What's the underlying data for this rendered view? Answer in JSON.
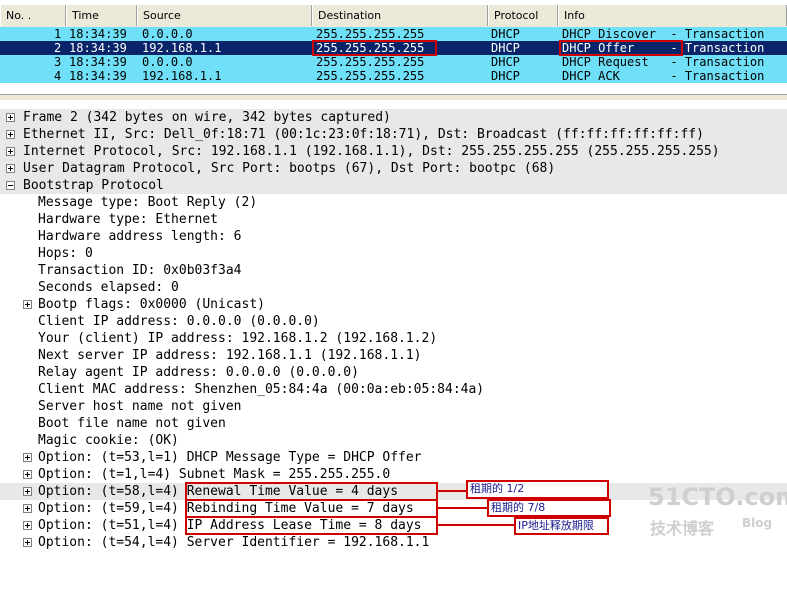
{
  "packet_list": {
    "columns": [
      "No. .",
      "Time",
      "Source",
      "Destination",
      "Protocol",
      "Info"
    ],
    "rows": [
      {
        "no": "1",
        "time": "18:34:39",
        "source": "0.0.0.0",
        "destination": "255.255.255.255",
        "protocol": "DHCP",
        "info": "DHCP Discover  - Transaction"
      },
      {
        "no": "2",
        "time": "18:34:39",
        "source": "192.168.1.1",
        "destination": "255.255.255.255",
        "protocol": "DHCP",
        "info": "DHCP Offer     - Transaction"
      },
      {
        "no": "3",
        "time": "18:34:39",
        "source": "0.0.0.0",
        "destination": "255.255.255.255",
        "protocol": "DHCP",
        "info": "DHCP Request   - Transaction"
      },
      {
        "no": "4",
        "time": "18:34:39",
        "source": "192.168.1.1",
        "destination": "255.255.255.255",
        "protocol": "DHCP",
        "info": "DHCP ACK       - Transaction"
      }
    ],
    "selected_row": 2
  },
  "detail_tree": [
    {
      "text": "Frame 2 (342 bytes on wire, 342 bytes captured)",
      "indent": 0,
      "expander": "plus"
    },
    {
      "text": "Ethernet II, Src: Dell_0f:18:71 (00:1c:23:0f:18:71), Dst: Broadcast (ff:ff:ff:ff:ff:ff)",
      "indent": 0,
      "expander": "plus"
    },
    {
      "text": "Internet Protocol, Src: 192.168.1.1 (192.168.1.1), Dst: 255.255.255.255 (255.255.255.255)",
      "indent": 0,
      "expander": "plus"
    },
    {
      "text": "User Datagram Protocol, Src Port: bootps (67), Dst Port: bootpc (68)",
      "indent": 0,
      "expander": "plus"
    },
    {
      "text": "Bootstrap Protocol",
      "indent": 0,
      "expander": "minus"
    },
    {
      "text": "Message type: Boot Reply (2)",
      "indent": 1,
      "expander": "none"
    },
    {
      "text": "Hardware type: Ethernet",
      "indent": 1,
      "expander": "none"
    },
    {
      "text": "Hardware address length: 6",
      "indent": 1,
      "expander": "none"
    },
    {
      "text": "Hops: 0",
      "indent": 1,
      "expander": "none"
    },
    {
      "text": "Transaction ID: 0x0b03f3a4",
      "indent": 1,
      "expander": "none"
    },
    {
      "text": "Seconds elapsed: 0",
      "indent": 1,
      "expander": "none"
    },
    {
      "text": "Bootp flags: 0x0000 (Unicast)",
      "indent": 1,
      "expander": "plus"
    },
    {
      "text": "Client IP address: 0.0.0.0 (0.0.0.0)",
      "indent": 1,
      "expander": "none"
    },
    {
      "text": "Your (client) IP address: 192.168.1.2 (192.168.1.2)",
      "indent": 1,
      "expander": "none"
    },
    {
      "text": "Next server IP address: 192.168.1.1 (192.168.1.1)",
      "indent": 1,
      "expander": "none"
    },
    {
      "text": "Relay agent IP address: 0.0.0.0 (0.0.0.0)",
      "indent": 1,
      "expander": "none"
    },
    {
      "text": "Client MAC address: Shenzhen_05:84:4a (00:0a:eb:05:84:4a)",
      "indent": 1,
      "expander": "none"
    },
    {
      "text": "Server host name not given",
      "indent": 1,
      "expander": "none"
    },
    {
      "text": "Boot file name not given",
      "indent": 1,
      "expander": "none"
    },
    {
      "text": "Magic cookie: (OK)",
      "indent": 1,
      "expander": "none"
    },
    {
      "text": "Option: (t=53,l=1) DHCP Message Type = DHCP Offer",
      "indent": 1,
      "expander": "plus"
    },
    {
      "text": "Option: (t=1,l=4) Subnet Mask = 255.255.255.0",
      "indent": 1,
      "expander": "plus"
    },
    {
      "text": "Option: (t=58,l=4) Renewal Time Value = 4 days",
      "indent": 1,
      "expander": "plus"
    },
    {
      "text": "Option: (t=59,l=4) Rebinding Time Value = 7 days",
      "indent": 1,
      "expander": "plus"
    },
    {
      "text": "Option: (t=51,l=4) IP Address Lease Time = 8 days",
      "indent": 1,
      "expander": "plus"
    },
    {
      "text": "Option: (t=54,l=4) Server Identifier = 192.168.1.1",
      "indent": 1,
      "expander": "plus"
    }
  ],
  "annotations": {
    "renewal": "租期的 1/2",
    "rebinding": "租期的 7/8",
    "lease": "IP地址释放期限"
  },
  "watermark": {
    "logo": "51CTO.com",
    "sub": "技术博客",
    "blog": "Blog"
  },
  "colors": {
    "selected_row": "#0a246a",
    "dhcp_row": "#70e0f8",
    "highlight_red": "#d00000"
  }
}
